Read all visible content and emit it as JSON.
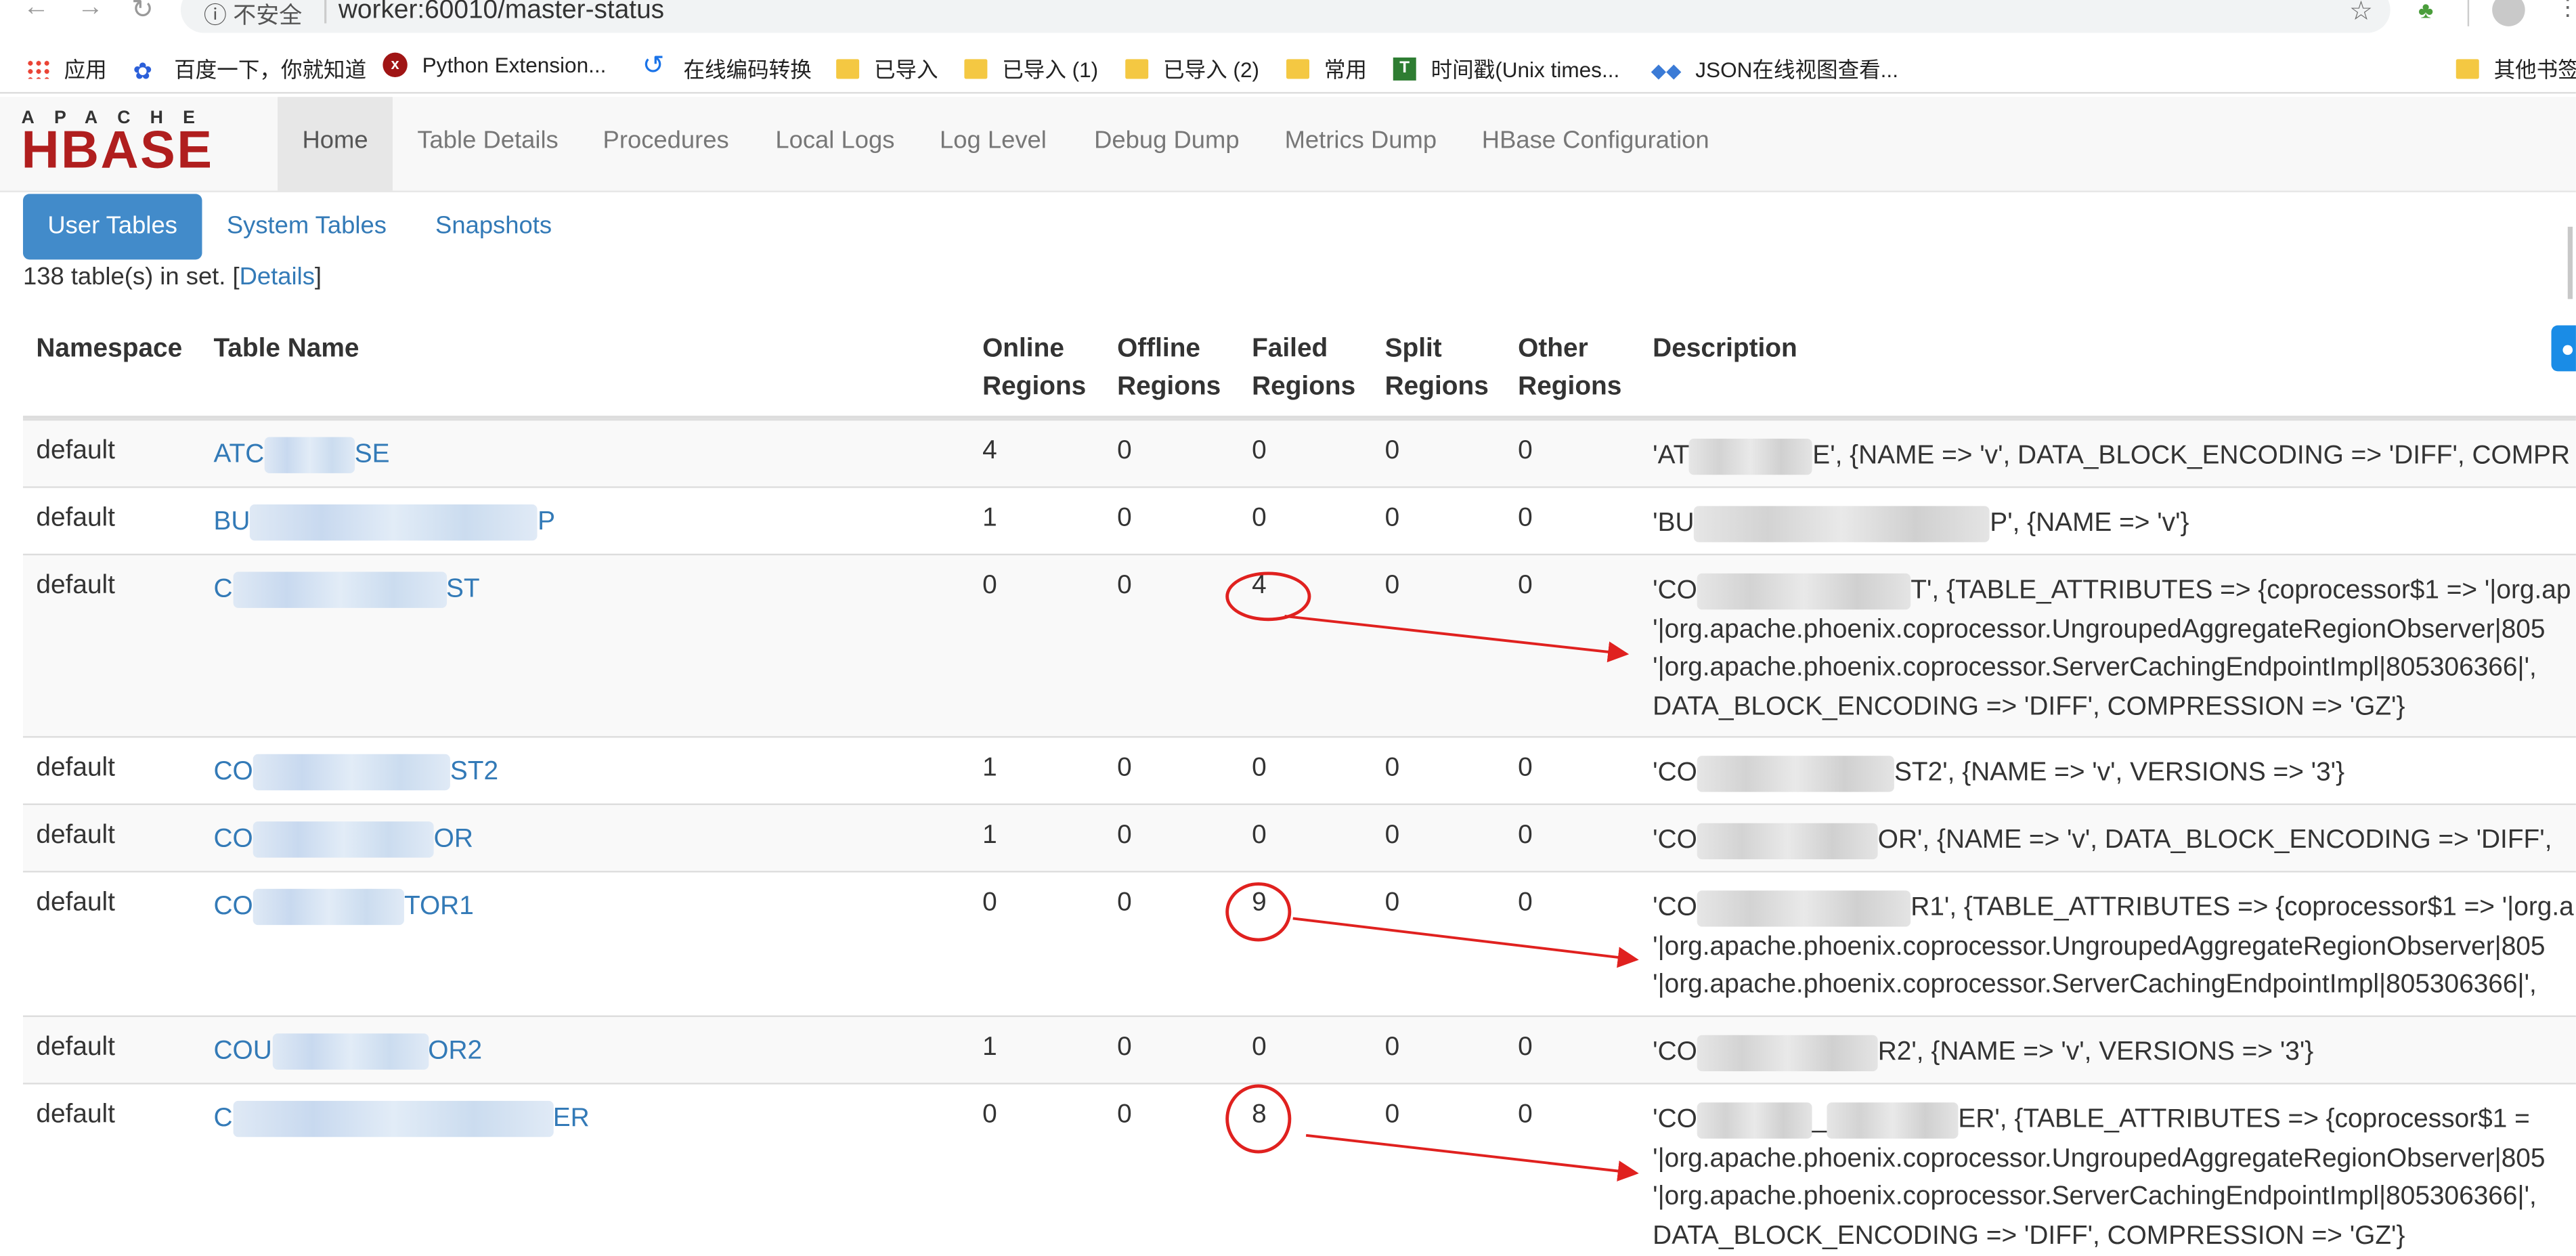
{
  "browser": {
    "insecure_label": "不安全",
    "url": "worker:60010/master-status",
    "bookmarks": [
      {
        "label": "应用",
        "icon": "apps-grid-icon"
      },
      {
        "label": "百度一下，你就知道",
        "icon": "baidu-icon"
      },
      {
        "label": "Python Extension...",
        "icon": "python-extension-icon"
      },
      {
        "label": "在线编码转换",
        "icon": "encode-icon"
      },
      {
        "label": "已导入",
        "icon": "folder-icon"
      },
      {
        "label": "已导入 (1)",
        "icon": "folder-icon"
      },
      {
        "label": "已导入 (2)",
        "icon": "folder-icon"
      },
      {
        "label": "常用",
        "icon": "folder-icon"
      },
      {
        "label": "时间戳(Unix times...",
        "icon": "timestamp-icon"
      },
      {
        "label": "JSON在线视图查看...",
        "icon": "json-icon"
      }
    ],
    "other_bookmarks": "其他书签"
  },
  "logo": {
    "top": "APACHE",
    "main": "HBASE"
  },
  "nav": [
    {
      "label": "Home",
      "active": true
    },
    {
      "label": "Table Details"
    },
    {
      "label": "Procedures"
    },
    {
      "label": "Local Logs"
    },
    {
      "label": "Log Level"
    },
    {
      "label": "Debug Dump"
    },
    {
      "label": "Metrics Dump"
    },
    {
      "label": "HBase Configuration"
    }
  ],
  "tabs": [
    {
      "label": "User Tables",
      "active": true
    },
    {
      "label": "System Tables"
    },
    {
      "label": "Snapshots"
    }
  ],
  "summary": {
    "prefix": "138 table(s) in set. [",
    "link": "Details",
    "suffix": "]"
  },
  "table": {
    "headers": {
      "namespace": "Namespace",
      "table_name": "Table Name",
      "online_1": "Online",
      "online_2": "Regions",
      "offline_1": "Offline",
      "offline_2": "Regions",
      "failed_1": "Failed",
      "failed_2": "Regions",
      "split_1": "Split",
      "split_2": "Regions",
      "other_1": "Other",
      "other_2": "Regions",
      "description": "Description"
    },
    "rows": [
      {
        "ns": "default",
        "name_a": "ATC",
        "name_b": "SE",
        "online": "4",
        "offline": "0",
        "failed": "0",
        "split": "0",
        "other": "0",
        "desc": [
          "'AT",
          "E', {NAME => 'v', DATA_BLOCK_ENCODING => 'DIFF', COMPR"
        ]
      },
      {
        "ns": "default",
        "name_a": "BU",
        "name_b": "P",
        "online": "1",
        "offline": "0",
        "failed": "0",
        "split": "0",
        "other": "0",
        "desc": [
          "'BU",
          "P', {NAME => 'v'}"
        ]
      },
      {
        "ns": "default",
        "name_a": "C",
        "name_b": "ST",
        "online": "0",
        "offline": "0",
        "failed": "4",
        "split": "0",
        "other": "0",
        "desc": [
          "'CO",
          "T', {TABLE_ATTRIBUTES => {coprocessor$1 => '|org.ap",
          "'|org.apache.phoenix.coprocessor.UngroupedAggregateRegionObserver|805",
          "'|org.apache.phoenix.coprocessor.ServerCachingEndpointImpl|805306366|',",
          "DATA_BLOCK_ENCODING => 'DIFF', COMPRESSION => 'GZ'}"
        ]
      },
      {
        "ns": "default",
        "name_a": "CO",
        "name_b": "ST2",
        "online": "1",
        "offline": "0",
        "failed": "0",
        "split": "0",
        "other": "0",
        "desc": [
          "'CO",
          "ST2', {NAME => 'v', VERSIONS => '3'}"
        ]
      },
      {
        "ns": "default",
        "name_a": "CO",
        "name_b": "OR",
        "online": "1",
        "offline": "0",
        "failed": "0",
        "split": "0",
        "other": "0",
        "desc": [
          "'CO",
          "OR', {NAME => 'v', DATA_BLOCK_ENCODING => 'DIFF',"
        ]
      },
      {
        "ns": "default",
        "name_a": "CO",
        "name_b": "TOR1",
        "online": "0",
        "offline": "0",
        "failed": "9",
        "split": "0",
        "other": "0",
        "desc": [
          "'CO",
          "R1', {TABLE_ATTRIBUTES => {coprocessor$1 => '|org.a",
          "'|org.apache.phoenix.coprocessor.UngroupedAggregateRegionObserver|805",
          "'|org.apache.phoenix.coprocessor.ServerCachingEndpointImpl|805306366|',"
        ]
      },
      {
        "ns": "default",
        "name_a": "COU",
        "name_b": "OR2",
        "online": "1",
        "offline": "0",
        "failed": "0",
        "split": "0",
        "other": "0",
        "desc": [
          "'CO",
          "R2', {NAME => 'v', VERSIONS => '3'}"
        ]
      },
      {
        "ns": "default",
        "name_a": "C",
        "name_b": "ER",
        "online": "0",
        "offline": "0",
        "failed": "8",
        "split": "0",
        "other": "0",
        "desc": [
          "'CO",
          "_",
          "ER', {TABLE_ATTRIBUTES => {coprocessor$1 =",
          "'|org.apache.phoenix.coprocessor.UngroupedAggregateRegionObserver|805",
          "'|org.apache.phoenix.coprocessor.ServerCachingEndpointImpl|805306366|',",
          "DATA_BLOCK_ENCODING => 'DIFF', COMPRESSION => 'GZ'}"
        ]
      }
    ]
  },
  "colors": {
    "annotation": "#e0211f",
    "link": "#337ab7",
    "active_tab": "#428bca",
    "logo_red": "#b01e1e"
  }
}
